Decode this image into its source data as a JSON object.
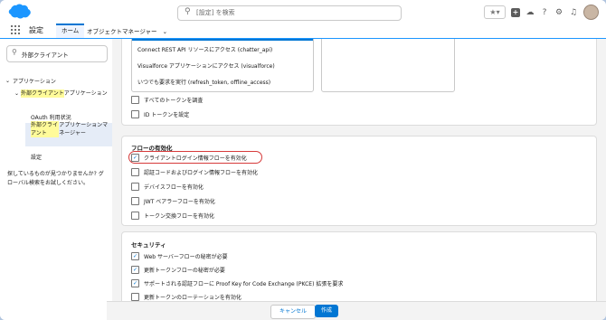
{
  "header": {
    "search_placeholder": "[設定] を検索",
    "icons": [
      "favorite-star-icon",
      "chevron-down-icon",
      "add-icon",
      "cloud-icon",
      "help-icon",
      "gear-icon",
      "bell-icon",
      "avatar"
    ]
  },
  "appnav": {
    "app_name": "設定",
    "tabs": [
      {
        "label": "ホーム"
      },
      {
        "label": "オブジェクトマネージャー"
      }
    ]
  },
  "sidebar": {
    "quick_find": "外部クライアント",
    "tree": {
      "root": "アプリケーション",
      "child": "外部クライアントアプリケーション",
      "child_hl": "外部クライアント",
      "child_rest": "アプリケーション",
      "items": [
        {
          "label": "OAuth 利用状況"
        },
        {
          "label_hl": "外部クライアント",
          "label_rest": "アプリケーションマネージャー"
        },
        {
          "label": "設定"
        }
      ]
    },
    "help_text": "探しているものが見つかりませんか? グローバル検索をお試しください。"
  },
  "main": {
    "scopes": [
      "Connect REST API リソースにアクセス (chatter_api)",
      "Visualforce アプリケーションにアクセス (visualforce)",
      "いつでも要求を実行 (refresh_token, offline_access)"
    ],
    "token_options": [
      {
        "label": "すべてのトークンを調査",
        "checked": false
      },
      {
        "label": "ID トークンを設定",
        "checked": false
      }
    ],
    "flow_section": {
      "title": "フローの有効化",
      "options": [
        {
          "label": "クライアントログイン情報フローを有効化",
          "checked": true
        },
        {
          "label": "認証コードおよびログイン情報フローを有効化",
          "checked": false
        },
        {
          "label": "デバイスフローを有効化",
          "checked": false
        },
        {
          "label": "JWT ベアラーフローを有効化",
          "checked": false
        },
        {
          "label": "トークン交換フローを有効化",
          "checked": false
        }
      ]
    },
    "security_section": {
      "title": "セキュリティ",
      "options": [
        {
          "label": "Web サーバーフローの秘密が必要",
          "checked": true
        },
        {
          "label": "更新トークンフローの秘密が必要",
          "checked": true
        },
        {
          "label": "サポートされる認証フローに Proof Key for Code Exchange (PKCE) 拡張を要求",
          "checked": true
        },
        {
          "label": "更新トークンのローテーションを有効化",
          "checked": false
        }
      ]
    }
  },
  "footer": {
    "cancel_label": "キャンセル",
    "create_label": "作成"
  },
  "colors": {
    "brand": "#0176d3",
    "highlight_ring": "#d63a3a",
    "search_highlight": "#fffb9a"
  }
}
